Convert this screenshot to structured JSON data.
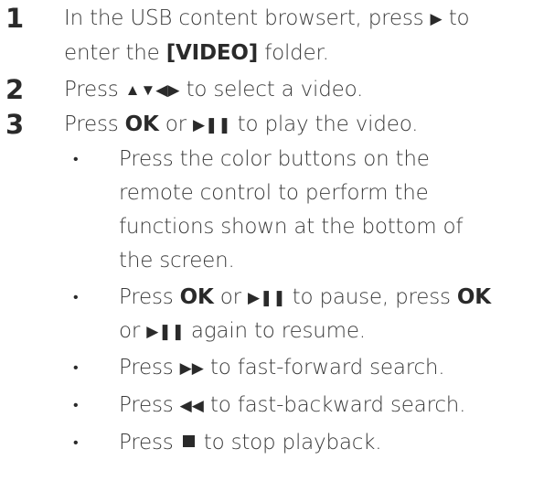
{
  "steps": [
    {
      "number": "1",
      "lines": [
        {
          "before": "In the USB content browsert, press ",
          "symbol": "▶",
          "after": " to"
        },
        {
          "before": "enter the ",
          "keyword": "[VIDEO]",
          "after": " folder."
        }
      ]
    },
    {
      "number": "2",
      "lines": [
        {
          "before": "Press ",
          "symbol": "▲▼◀▶",
          "after": " to select a video."
        }
      ]
    },
    {
      "number": "3",
      "lines": [
        {
          "before": "Press ",
          "keyword": "OK",
          "mid": " or ",
          "symbol": "▶❚❚",
          "after": " to play the video."
        }
      ]
    }
  ],
  "bullets": [
    {
      "marker": "•",
      "lines": [
        {
          "text": "Press the color buttons on the"
        },
        {
          "text": "remote control to perform the"
        },
        {
          "text": "functions shown at the bottom of"
        },
        {
          "text": "the screen."
        }
      ]
    },
    {
      "marker": "•",
      "lines": [
        {
          "before": "Press ",
          "keyword": "OK",
          "mid": " or ",
          "symbol": "▶❚❚",
          "mid2": " to pause, press ",
          "keyword2": "OK"
        },
        {
          "before": "or ",
          "symbol": "▶❚❚",
          "after": " again to resume."
        }
      ]
    },
    {
      "marker": "•",
      "lines": [
        {
          "before": "Press ",
          "symbol": "▶▶",
          "after": " to fast-forward search."
        }
      ]
    },
    {
      "marker": "•",
      "lines": [
        {
          "before": "Press ",
          "symbol": "◀◀",
          "after": " to fast-backward search."
        }
      ]
    },
    {
      "marker": "•",
      "lines": [
        {
          "before": "Press ",
          "stop_icon": "stop-icon",
          "after": " to stop playback."
        }
      ]
    }
  ]
}
